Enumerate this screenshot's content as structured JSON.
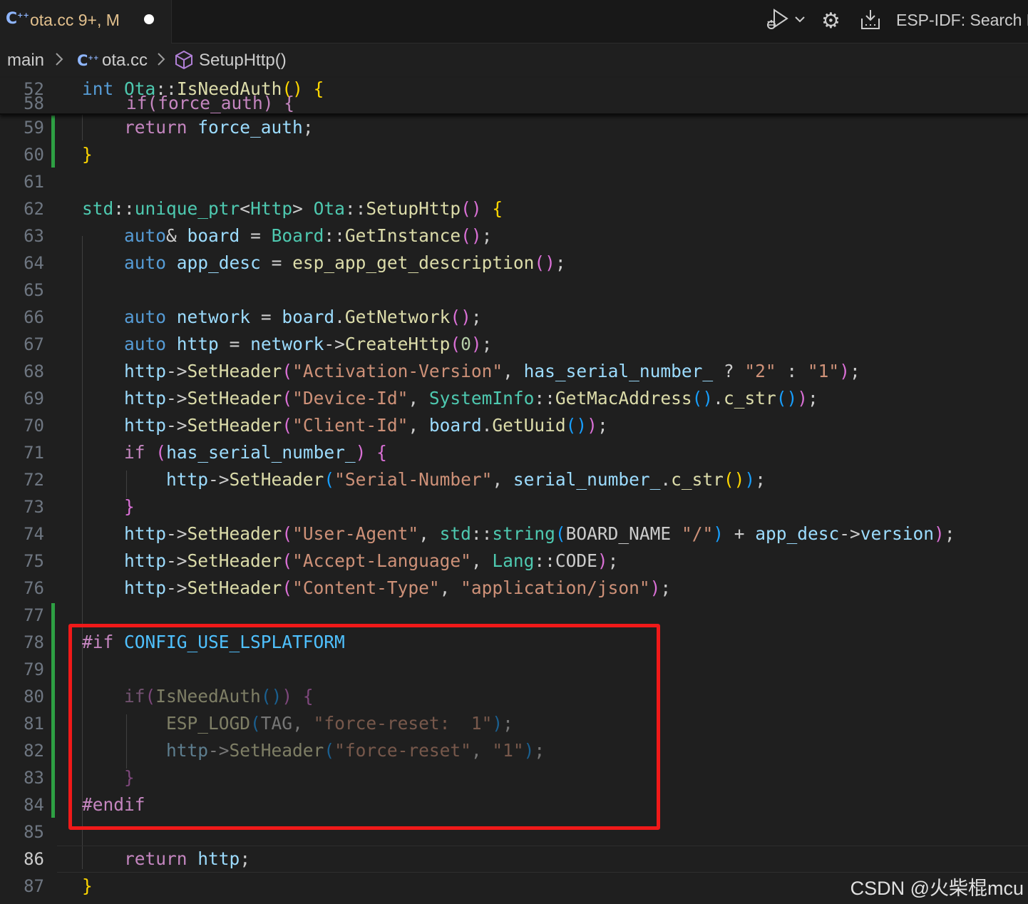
{
  "tab": {
    "filename": "ota.cc",
    "problems": "9+, M"
  },
  "toolbar": {
    "espidf_label": "ESP-IDF: Search Err"
  },
  "breadcrumb": {
    "folder": "main",
    "file": "ota.cc",
    "symbol": "SetupHttp()"
  },
  "sticky": {
    "line_no": "52",
    "partial_line_no": "58",
    "partial_text": "if(force_auth) {"
  },
  "current_line": "86",
  "watermark": "CSDN @火柴棍mcu",
  "lines": [
    {
      "n": "59",
      "t": [
        [
          "    "
        ],
        [
          "return",
          "ctl"
        ],
        [
          " "
        ],
        [
          "force_auth",
          "var"
        ],
        [
          ";"
        ]
      ]
    },
    {
      "n": "60",
      "t": [
        [
          "}",
          "b1"
        ]
      ]
    },
    {
      "n": "61",
      "t": []
    },
    {
      "n": "62",
      "t": [
        [
          "std",
          "ty"
        ],
        [
          "::"
        ],
        [
          "unique_ptr",
          "ty"
        ],
        [
          "<"
        ],
        [
          "Http",
          "ty"
        ],
        [
          "> "
        ],
        [
          "Ota",
          "ty"
        ],
        [
          "::"
        ],
        [
          "SetupHttp",
          "fn"
        ],
        [
          "()",
          "b2"
        ],
        [
          " "
        ],
        [
          "{",
          "b1"
        ]
      ]
    },
    {
      "n": "63",
      "t": [
        [
          "    "
        ],
        [
          "auto",
          "kw"
        ],
        [
          "& "
        ],
        [
          "board",
          "var"
        ],
        [
          " = "
        ],
        [
          "Board",
          "ty"
        ],
        [
          "::"
        ],
        [
          "GetInstance",
          "fn"
        ],
        [
          "()",
          "b2"
        ],
        [
          ";"
        ]
      ]
    },
    {
      "n": "64",
      "t": [
        [
          "    "
        ],
        [
          "auto",
          "kw"
        ],
        [
          " "
        ],
        [
          "app_desc",
          "var"
        ],
        [
          " = "
        ],
        [
          "esp_app_get_description",
          "fn"
        ],
        [
          "()",
          "b2"
        ],
        [
          ";"
        ]
      ]
    },
    {
      "n": "65",
      "t": []
    },
    {
      "n": "66",
      "t": [
        [
          "    "
        ],
        [
          "auto",
          "kw"
        ],
        [
          " "
        ],
        [
          "network",
          "var"
        ],
        [
          " = "
        ],
        [
          "board",
          "var"
        ],
        [
          "."
        ],
        [
          "GetNetwork",
          "fn"
        ],
        [
          "()",
          "b2"
        ],
        [
          ";"
        ]
      ]
    },
    {
      "n": "67",
      "t": [
        [
          "    "
        ],
        [
          "auto",
          "kw"
        ],
        [
          " "
        ],
        [
          "http",
          "var"
        ],
        [
          " = "
        ],
        [
          "network",
          "var"
        ],
        [
          "->"
        ],
        [
          "CreateHttp",
          "fn"
        ],
        [
          "(",
          "b2"
        ],
        [
          "0",
          "num"
        ],
        [
          ")",
          "b2"
        ],
        [
          ";"
        ]
      ]
    },
    {
      "n": "68",
      "t": [
        [
          "    "
        ],
        [
          "http",
          "var"
        ],
        [
          "->"
        ],
        [
          "SetHeader",
          "fn"
        ],
        [
          "(",
          "b2"
        ],
        [
          "\"Activation-Version\"",
          "str"
        ],
        [
          ", "
        ],
        [
          "has_serial_number_",
          "var"
        ],
        [
          " ? "
        ],
        [
          "\"2\"",
          "str"
        ],
        [
          " : "
        ],
        [
          "\"1\"",
          "str"
        ],
        [
          ")",
          "b2"
        ],
        [
          ";"
        ]
      ]
    },
    {
      "n": "69",
      "t": [
        [
          "    "
        ],
        [
          "http",
          "var"
        ],
        [
          "->"
        ],
        [
          "SetHeader",
          "fn"
        ],
        [
          "(",
          "b2"
        ],
        [
          "\"Device-Id\"",
          "str"
        ],
        [
          ", "
        ],
        [
          "SystemInfo",
          "ty"
        ],
        [
          "::"
        ],
        [
          "GetMacAddress",
          "fn"
        ],
        [
          "()",
          "b3"
        ],
        [
          "."
        ],
        [
          "c_str",
          "fn"
        ],
        [
          "()",
          "b3"
        ],
        [
          ")",
          "b2"
        ],
        [
          ";"
        ]
      ]
    },
    {
      "n": "70",
      "t": [
        [
          "    "
        ],
        [
          "http",
          "var"
        ],
        [
          "->"
        ],
        [
          "SetHeader",
          "fn"
        ],
        [
          "(",
          "b2"
        ],
        [
          "\"Client-Id\"",
          "str"
        ],
        [
          ", "
        ],
        [
          "board",
          "var"
        ],
        [
          "."
        ],
        [
          "GetUuid",
          "fn"
        ],
        [
          "()",
          "b3"
        ],
        [
          ")",
          "b2"
        ],
        [
          ";"
        ]
      ]
    },
    {
      "n": "71",
      "t": [
        [
          "    "
        ],
        [
          "if",
          "ctl"
        ],
        [
          " "
        ],
        [
          "(",
          "b2"
        ],
        [
          "has_serial_number_",
          "var"
        ],
        [
          ")",
          "b2"
        ],
        [
          " "
        ],
        [
          "{",
          "b2"
        ]
      ]
    },
    {
      "n": "72",
      "t": [
        [
          "        "
        ],
        [
          "http",
          "var"
        ],
        [
          "->"
        ],
        [
          "SetHeader",
          "fn"
        ],
        [
          "(",
          "b3"
        ],
        [
          "\"Serial-Number\"",
          "str"
        ],
        [
          ", "
        ],
        [
          "serial_number_",
          "var"
        ],
        [
          "."
        ],
        [
          "c_str",
          "fn"
        ],
        [
          "()",
          "b1"
        ],
        [
          ")",
          "b3"
        ],
        [
          ";"
        ]
      ]
    },
    {
      "n": "73",
      "t": [
        [
          "    "
        ],
        [
          "}",
          "b2"
        ]
      ]
    },
    {
      "n": "74",
      "t": [
        [
          "    "
        ],
        [
          "http",
          "var"
        ],
        [
          "->"
        ],
        [
          "SetHeader",
          "fn"
        ],
        [
          "(",
          "b2"
        ],
        [
          "\"User-Agent\"",
          "str"
        ],
        [
          ", "
        ],
        [
          "std",
          "ty"
        ],
        [
          "::"
        ],
        [
          "string",
          "ty"
        ],
        [
          "(",
          "b3"
        ],
        [
          "BOARD_NAME",
          "pun"
        ],
        [
          " "
        ],
        [
          "\"/\"",
          "str"
        ],
        [
          ")",
          "b3"
        ],
        [
          " + "
        ],
        [
          "app_desc",
          "var"
        ],
        [
          "->"
        ],
        [
          "version",
          "var"
        ],
        [
          ")",
          "b2"
        ],
        [
          ";"
        ]
      ]
    },
    {
      "n": "75",
      "t": [
        [
          "    "
        ],
        [
          "http",
          "var"
        ],
        [
          "->"
        ],
        [
          "SetHeader",
          "fn"
        ],
        [
          "(",
          "b2"
        ],
        [
          "\"Accept-Language\"",
          "str"
        ],
        [
          ", "
        ],
        [
          "Lang",
          "ty"
        ],
        [
          "::"
        ],
        [
          "CODE",
          "pun"
        ],
        [
          ")",
          "b2"
        ],
        [
          ";"
        ]
      ]
    },
    {
      "n": "76",
      "t": [
        [
          "    "
        ],
        [
          "http",
          "var"
        ],
        [
          "->"
        ],
        [
          "SetHeader",
          "fn"
        ],
        [
          "(",
          "b2"
        ],
        [
          "\"Content-Type\"",
          "str"
        ],
        [
          ", "
        ],
        [
          "\"application/json\"",
          "str"
        ],
        [
          ")",
          "b2"
        ],
        [
          ";"
        ]
      ]
    },
    {
      "n": "77",
      "t": []
    },
    {
      "n": "78",
      "t": [
        [
          "#if",
          "pre"
        ],
        [
          " "
        ],
        [
          "CONFIG_USE_LSPLATFORM",
          "mac"
        ]
      ]
    },
    {
      "n": "79",
      "t": []
    },
    {
      "n": "80",
      "t": [
        [
          "    "
        ],
        [
          "if",
          "ctl dim"
        ],
        [
          "(",
          "b2 dim"
        ],
        [
          "IsNeedAuth",
          "fn dim"
        ],
        [
          "()",
          "b3 dim"
        ],
        [
          ")",
          "b2 dim"
        ],
        [
          " "
        ],
        [
          "{",
          "b2 dim"
        ]
      ]
    },
    {
      "n": "81",
      "t": [
        [
          "        "
        ],
        [
          "ESP_LOGD",
          "fn dim"
        ],
        [
          "(",
          "b3 dim"
        ],
        [
          "TAG",
          "pun dim"
        ],
        [
          ", ",
          "pun dim"
        ],
        [
          "\"force-reset:  1\"",
          "str dim"
        ],
        [
          ")",
          "b3 dim"
        ],
        [
          ";",
          "pun dim"
        ]
      ]
    },
    {
      "n": "82",
      "t": [
        [
          "        "
        ],
        [
          "http",
          "var dim"
        ],
        [
          "->",
          "pun dim"
        ],
        [
          "SetHeader",
          "fn dim"
        ],
        [
          "(",
          "b3 dim"
        ],
        [
          "\"force-reset\"",
          "str dim"
        ],
        [
          ", ",
          "pun dim"
        ],
        [
          "\"1\"",
          "str dim"
        ],
        [
          ")",
          "b3 dim"
        ],
        [
          ";",
          "pun dim"
        ]
      ]
    },
    {
      "n": "83",
      "t": [
        [
          "    "
        ],
        [
          "}",
          "b2 dim"
        ]
      ]
    },
    {
      "n": "84",
      "t": [
        [
          "#endif",
          "pre"
        ]
      ]
    },
    {
      "n": "85",
      "t": []
    },
    {
      "n": "86",
      "t": [
        [
          "    "
        ],
        [
          "return",
          "ctl"
        ],
        [
          " "
        ],
        [
          "http",
          "var"
        ],
        [
          ";"
        ]
      ]
    },
    {
      "n": "87",
      "t": [
        [
          "}",
          "b1"
        ]
      ]
    }
  ]
}
